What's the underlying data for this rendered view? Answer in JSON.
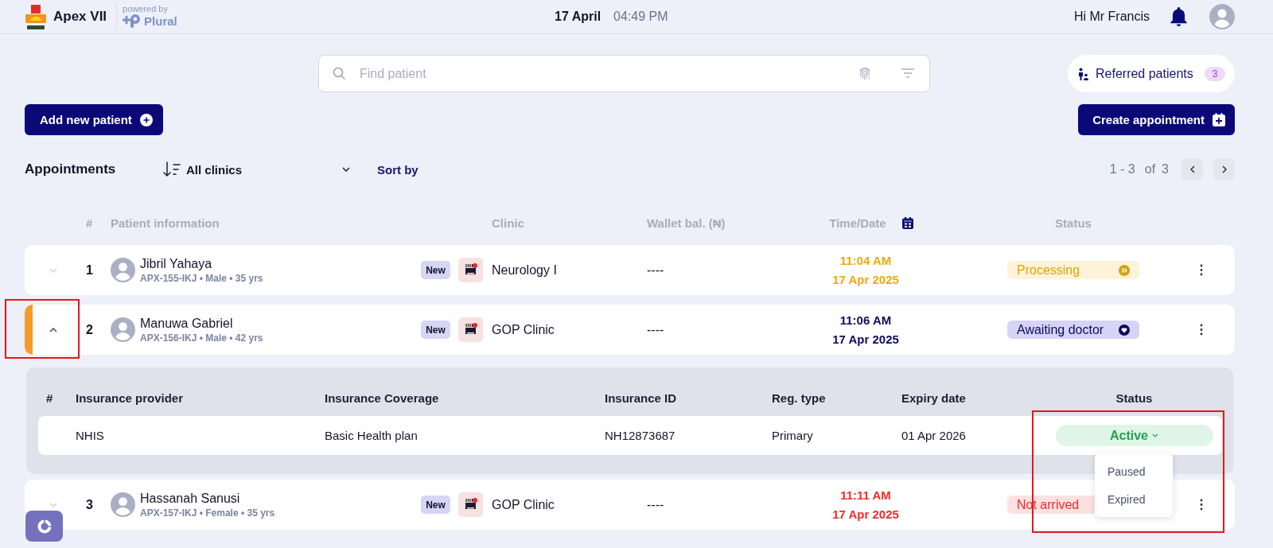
{
  "header": {
    "brand": "Apex VII",
    "powered_by": "powered by",
    "partner": "Plural",
    "date": "17 April",
    "time": "04:49 PM",
    "greeting": "Hi Mr Francis"
  },
  "search": {
    "placeholder": "Find patient"
  },
  "referred": {
    "label": "Referred patients",
    "count": "3"
  },
  "actions": {
    "add_patient": "Add new patient",
    "create_appointment": "Create appointment"
  },
  "toolbar": {
    "title": "Appointments",
    "clinic_filter": "All clinics",
    "sort": "Sort by",
    "range": "1 - 3",
    "of": "of",
    "total": "3"
  },
  "table": {
    "columns": [
      "#",
      "Patient information",
      "Clinic",
      "Wallet bal. (₦)",
      "Time/Date",
      "Status"
    ],
    "rows": [
      {
        "index": "1",
        "name": "Jibril Yahaya",
        "details": "APX-155-IKJ • Male • 35 yrs",
        "tag": "New",
        "clinic": "Neurology I",
        "wallet": "----",
        "time": "11:04 AM",
        "date": "17 Apr 2025",
        "status": {
          "label": "Processing",
          "kind": "processing"
        },
        "expanded": false,
        "highlighted": false
      },
      {
        "index": "2",
        "name": "Manuwa Gabriel",
        "details": "APX-156-IKJ • Male • 42 yrs",
        "tag": "New",
        "clinic": "GOP Clinic",
        "wallet": "----",
        "time": "11:06 AM",
        "date": "17 Apr 2025",
        "status": {
          "label": "Awaiting doctor",
          "kind": "awaiting"
        },
        "expanded": true,
        "highlighted": true,
        "insurance": {
          "columns": [
            "#",
            "Insurance provider",
            "Insurance Coverage",
            "Insurance ID",
            "Reg. type",
            "Expiry date",
            "Status"
          ],
          "rows": [
            {
              "provider": "NHIS",
              "coverage": "Basic Health plan",
              "id": "NH12873687",
              "reg_type": "Primary",
              "expiry": "01 Apr 2026",
              "status": {
                "label": "Active",
                "kind": "active"
              },
              "menu_open": true,
              "menu": [
                "Paused",
                "Expired"
              ],
              "highlighted": true
            }
          ]
        }
      },
      {
        "index": "3",
        "name": "Hassanah Sanusi",
        "details": "APX-157-IKJ • Female • 35 yrs",
        "tag": "New",
        "clinic": "GOP Clinic",
        "wallet": "----",
        "time": "11:11 AM",
        "date": "17 Apr 2025",
        "status": {
          "label": "Not arrived",
          "kind": "not_arrived"
        },
        "expanded": false,
        "highlighted": false
      }
    ]
  }
}
